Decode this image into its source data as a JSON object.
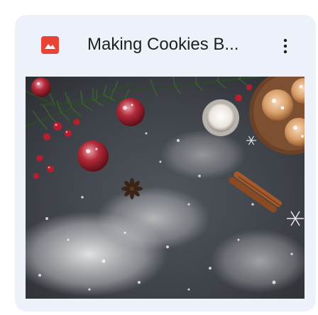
{
  "card": {
    "title": "Making Cookies B...",
    "file_type_icon": "image-file-icon",
    "menu_icon": "more-vert-icon",
    "thumbnail_icon": "christmas-baking-photo"
  },
  "colors": {
    "card_background": "#edf2fa",
    "file_icon_red": "#ea4335",
    "title_text": "#1f1f1f"
  }
}
